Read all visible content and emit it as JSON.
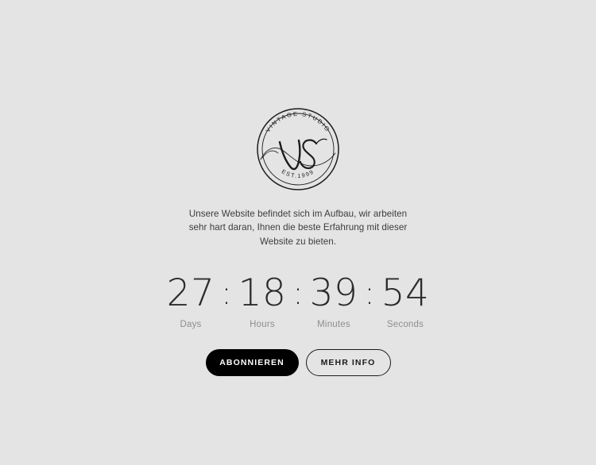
{
  "page": {
    "background_color": "#e4e4e4",
    "text_color": "#3c3c3c"
  },
  "logo": {
    "name": "vintage-studio-emblem",
    "top_arc_text": "VINTAGE STUDIO",
    "bottom_arc_text": "EST.1999",
    "monogram": "VS",
    "stroke_color": "#1d1d1d"
  },
  "intro": {
    "text": "Unsere Website befindet sich im Aufbau, wir arbeiten sehr hart daran, Ihnen die beste Erfahrung mit dieser Website zu bieten."
  },
  "countdown": {
    "separator": ":",
    "units": [
      {
        "value": "27",
        "label": "Days"
      },
      {
        "value": "18",
        "label": "Hours"
      },
      {
        "value": "39",
        "label": "Minutes"
      },
      {
        "value": "54",
        "label": "Seconds"
      }
    ],
    "value_color": "#2b2b2b",
    "label_color": "#8e8e8e"
  },
  "actions": {
    "subscribe_label": "ABONNIEREN",
    "more_info_label": "MEHR INFO",
    "primary_bg": "#000000",
    "primary_fg": "#ffffff",
    "secondary_border": "#1b1b1b",
    "secondary_fg": "#1b1b1b"
  }
}
